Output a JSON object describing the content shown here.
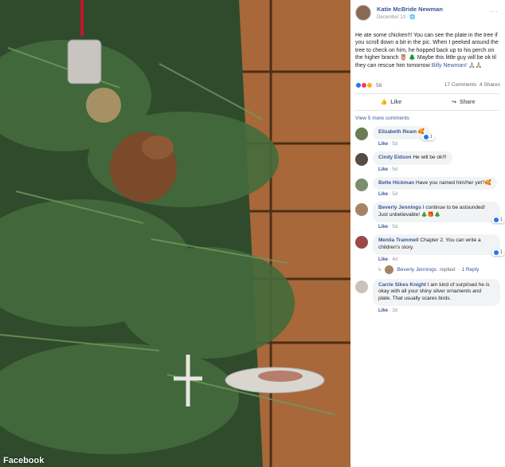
{
  "watermark": "Facebook",
  "post": {
    "author": "Katie McBride Newman",
    "date": "December 13",
    "text": "He ate some chicken!!! You can see the plate in the tree if you scroll down a bit in the pic. When I peeked around the tree to check on him, he hopped back up to his perch on the higher branch 🦉 🌲 Maybe this little guy will be ok til they can rescue him tomorrow",
    "tag": "Billy Newman!",
    "tag_suffix": " 🙏🏼🙏🏼",
    "reaction_count": "58",
    "comments_count": "17 Comments",
    "shares_count": "4 Shares",
    "like_label": "Like",
    "share_label": "Share",
    "view_more": "View 5 more comments"
  },
  "comments": [
    {
      "name": "Elizabeth Ream",
      "text": "🥰",
      "like": "Like",
      "time": "5d",
      "reacts": "1",
      "avatar_color": "#6b7b55"
    },
    {
      "name": "Cindy Eidson",
      "text": "He will be ok!!!",
      "like": "Like",
      "time": "5d",
      "reacts": "",
      "avatar_color": "#5a4b40"
    },
    {
      "name": "Bette Hickman",
      "text": "Have you named him/her yet?🥰",
      "like": "Like",
      "time": "5d",
      "reacts": "",
      "avatar_color": "#7d8c6a"
    },
    {
      "name": "Beverly Jennings",
      "text": "I continue to be astounded! Just unbelievable! 🎄🎁🎄",
      "like": "Like",
      "time": "5d",
      "reacts": "1",
      "avatar_color": "#a58466"
    },
    {
      "name": "Menlia Trammell",
      "text": "Chapter 2. You can write a children's story.",
      "like": "Like",
      "time": "4d",
      "reacts": "1",
      "avatar_color": "#9a4a4a"
    },
    {
      "name": "Carrie Sikes Knight",
      "text": "I am kind of surprised he is okay with all your shiny silver ornaments and plate. That usually scares birds.",
      "like": "Like",
      "time": "3d",
      "reacts": "",
      "avatar_color": "#c9c2b8"
    }
  ],
  "reply_summary": {
    "name": "Beverly Jennings",
    "action": "replied",
    "count": "· 1 Reply"
  }
}
